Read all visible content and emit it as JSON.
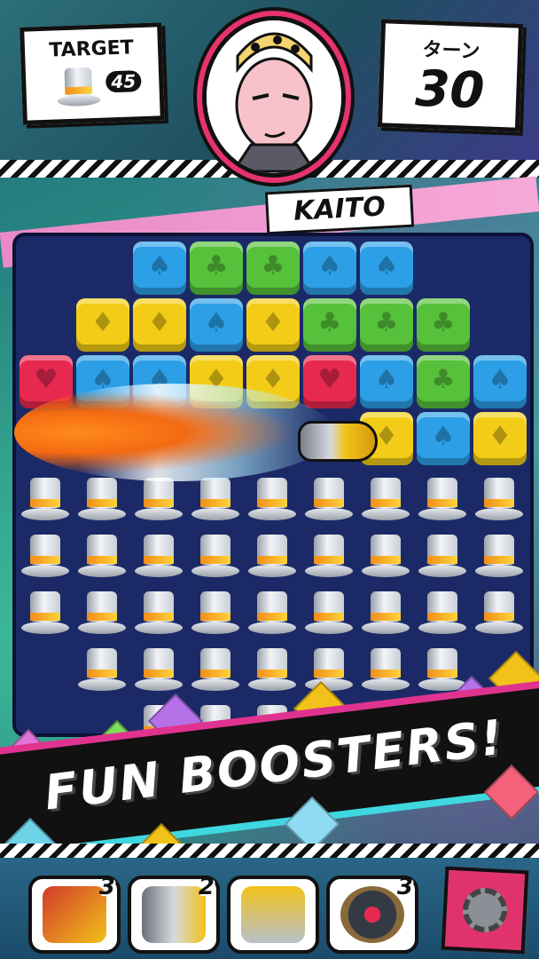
{
  "header": {
    "target_label": "TARGET",
    "target_count": "45",
    "target_icon": "top-hat-icon",
    "turns_label": "ターン",
    "turns_value": "30",
    "character_name": "KAITO"
  },
  "board": {
    "tile_rows": [
      [
        "",
        "blue",
        "green",
        "green",
        "blue",
        "blue",
        "",
        ""
      ],
      [
        "yellow",
        "yellow",
        "blue",
        "yellow",
        "green",
        "green",
        "green",
        ""
      ],
      [
        "red",
        "blue",
        "blue",
        "yellow",
        "yellow",
        "red",
        "blue",
        "green",
        "blue"
      ],
      [
        "",
        "",
        "",
        "",
        "",
        "",
        "yellow",
        "blue",
        "yellow"
      ]
    ],
    "suits": {
      "blue": "♠",
      "green": "♣",
      "yellow": "♦",
      "red": "♥"
    }
  },
  "banner": {
    "text": "FUN BOOSTERS!"
  },
  "boosters": [
    {
      "name": "rocket-booster-icon",
      "count": "3",
      "color": "#f2c21a"
    },
    {
      "name": "bullet-booster-icon",
      "count": "2",
      "color": "#9aa0aa"
    },
    {
      "name": "drill-booster-icon",
      "count": "",
      "color": "#f2c21a"
    },
    {
      "name": "roulette-booster-icon",
      "count": "3",
      "color": "#333a44"
    }
  ],
  "settings": {
    "icon": "gear-icon"
  },
  "colors": {
    "blue": "#2c9fe6",
    "green": "#56c13a",
    "yellow": "#f2cc17",
    "red": "#e8294f",
    "board": "#1b2a66",
    "accent_pink": "#e0336d"
  }
}
